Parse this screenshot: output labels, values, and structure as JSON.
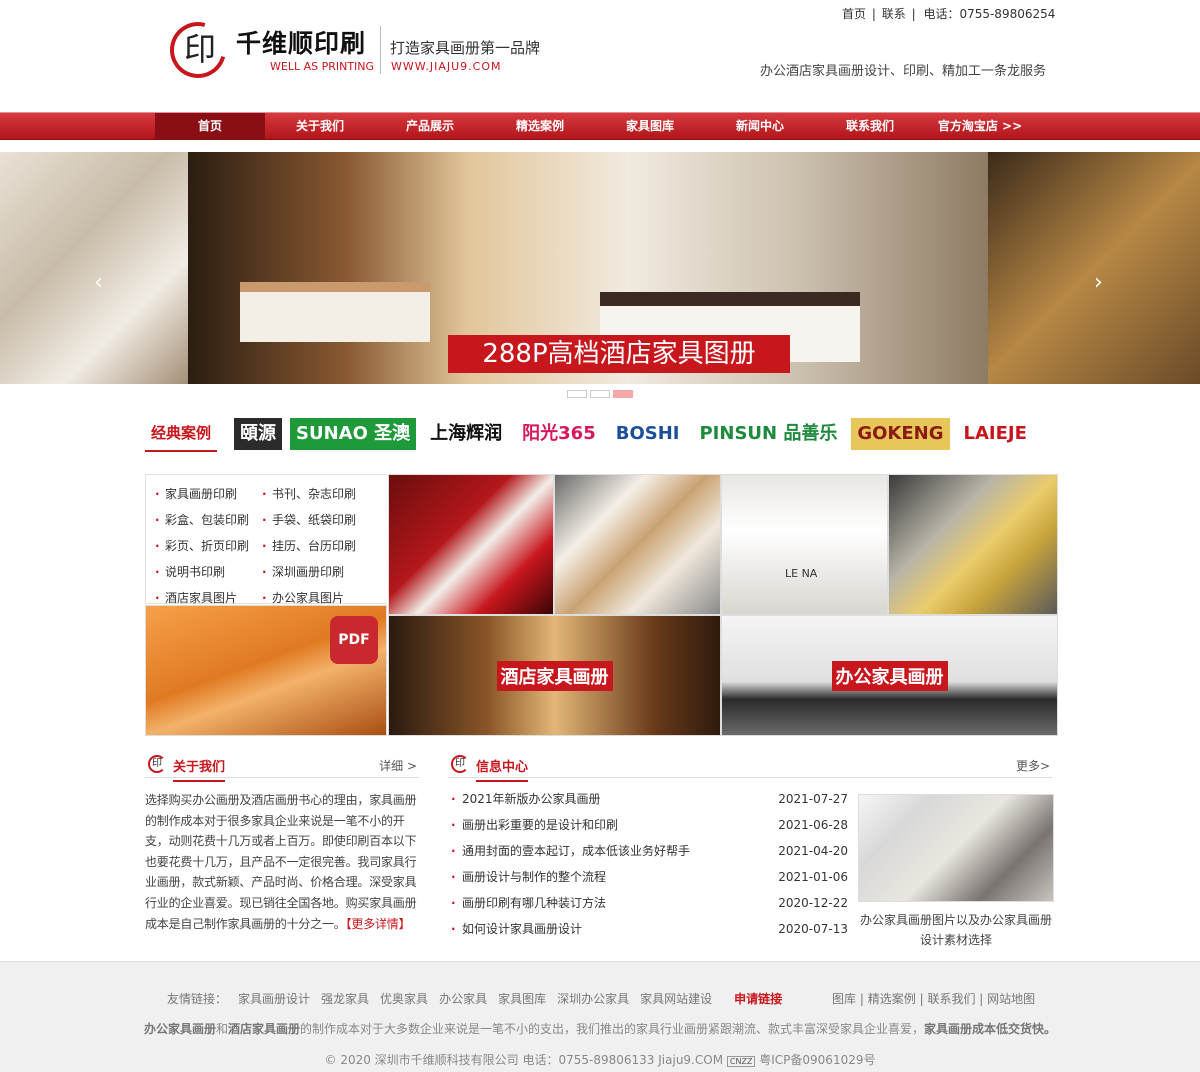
{
  "header": {
    "logo_cn": "千维顺印刷",
    "logo_en": "WELL AS PRINTING",
    "logo_seal": "印",
    "slogan": "打造家具画册第一品牌",
    "site": "WWW.JIAJU9.COM",
    "toplinks": [
      "首页",
      "联系",
      "电话：0755-89806254"
    ],
    "toplink_sep": "|",
    "tagline": "办公酒店家具画册设计、印刷、精加工一条龙服务"
  },
  "nav": [
    "首页",
    "关于我们",
    "产品展示",
    "精选案例",
    "家具图库",
    "新闻中心",
    "联系我们",
    "官方淘宝店 >>"
  ],
  "banner": {
    "caption": "288P高档酒店家具图册",
    "prev": "‹",
    "next": "›",
    "active_slide": 3
  },
  "brands": {
    "label": "经典案例",
    "logos": [
      {
        "text": "頤源",
        "color": "#ffffff",
        "bg": "#2b2b2b"
      },
      {
        "text": "SUNAO 圣澳",
        "color": "#ffffff",
        "bg": "#1f9a3b"
      },
      {
        "text": "上海辉润",
        "color": "#111111",
        "bg": "#ffffff"
      },
      {
        "text": "阳光365",
        "color": "#d6185c",
        "bg": "#ffffff"
      },
      {
        "text": "BOSHI",
        "color": "#1b4f9c",
        "bg": "#ffffff"
      },
      {
        "text": "PINSUN 品善乐",
        "color": "#1e8b3c",
        "bg": "#ffffff"
      },
      {
        "text": "GOKENG",
        "color": "#8a1a12",
        "bg": "#e8c75a"
      },
      {
        "text": "LAIEJE",
        "color": "#c8161d",
        "bg": "#ffffff"
      }
    ]
  },
  "categories": [
    [
      "家具画册印刷",
      "书刊、杂志印刷"
    ],
    [
      "彩盒、包装印刷",
      "手袋、纸袋印刷"
    ],
    [
      "彩页、折页印刷",
      "挂历、台历印刷"
    ],
    [
      "说明书印刷",
      "深圳画册印刷"
    ],
    [
      "酒店家具图片",
      "办公家具图片"
    ]
  ],
  "tiles": {
    "pdf": "PDF",
    "hotel": "酒店家具画册",
    "office": "办公家具画册",
    "bag_text": "LE NA"
  },
  "about": {
    "title": "关于我们",
    "more": "详细 >",
    "text": "选择购买办公画册及酒店画册书心的理由，家具画册的制作成本对于很多家具企业来说是一笔不小的开支，动则花费十几万或者上百万。即使印刷百本以下也要花费十几万，且产品不一定很完善。我司家具行业画册，款式新颖、产品时尚、价格合理。深受家具行业的企业喜爱。现已销往全国各地。购买家具画册成本是自己制作家具画册的十分之一。",
    "link": "【更多详情】"
  },
  "info": {
    "title": "信息中心",
    "more": "更多>",
    "news": [
      {
        "title": "2021年新版办公家具画册",
        "date": "2021-07-27"
      },
      {
        "title": "画册出彩重要的是设计和印刷",
        "date": "2021-06-28"
      },
      {
        "title": "通用封面的壹本起订，成本低该业务好帮手",
        "date": "2021-04-20"
      },
      {
        "title": "画册设计与制作的整个流程",
        "date": "2021-01-06"
      },
      {
        "title": "画册印刷有哪几种装订方法",
        "date": "2020-12-22"
      },
      {
        "title": "如何设计家具画册设计",
        "date": "2020-07-13"
      }
    ],
    "caption": "办公家具画册图片以及办公家具画册设计素材选择"
  },
  "footer": {
    "friends_label": "友情链接：",
    "friends": [
      "家具画册设计",
      "强龙家具",
      "优奥家具",
      "办公家具",
      "家具图库",
      "深圳办公家具",
      "家具网站建设"
    ],
    "apply": "申请链接",
    "links": [
      "图库",
      "精选案例",
      "联系我们",
      "网站地图"
    ],
    "link_sep": "|",
    "desc_b1": "办公家具画册",
    "desc_and": "和",
    "desc_b2": "酒店家具画册",
    "desc_mid": "的制作成本对于大多数企业来说是一笔不小的支出，我们推出的家具行业画册紧跟潮流、款式丰富深受家具企业喜爱，",
    "desc_b3": "家具画册成本低交货快。",
    "copyright": "© 2020 深圳市千维顺科技有限公司 电话：0755-89806133 Jiaju9.COM",
    "cnzz": "CNZZ",
    "icp": "粤ICP备09061029号"
  },
  "colors": {
    "brand_red": "#c8161d",
    "nav_dark": "#8a0f14"
  }
}
